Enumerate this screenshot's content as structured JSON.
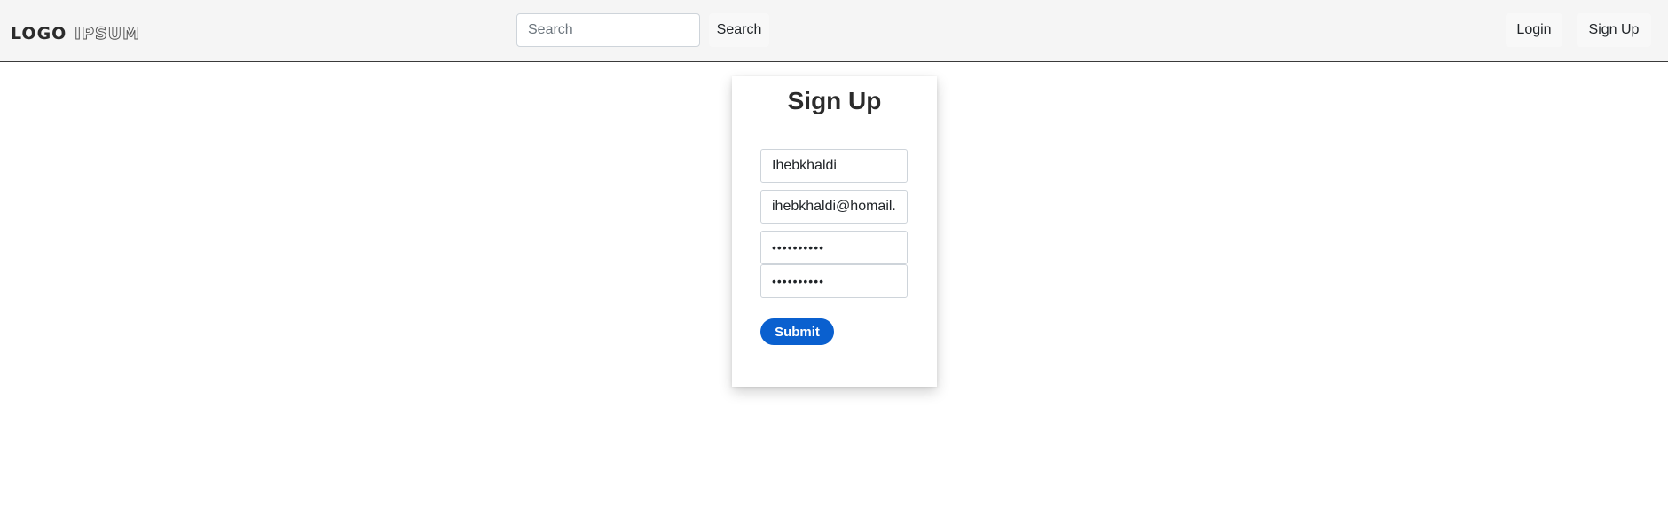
{
  "header": {
    "logo_text": "LOGOIPSUM",
    "search": {
      "placeholder": "Search",
      "value": ""
    },
    "search_button_label": "Search",
    "login_label": "Login",
    "signup_label": "Sign Up"
  },
  "signup_form": {
    "title": "Sign Up",
    "username": "Ihebkhaldi",
    "email": "ihebkhaldi@homail.",
    "password": "••••••••••",
    "confirm_password": "••••••••••",
    "submit_label": "Submit"
  },
  "colors": {
    "navbar_bg": "#f5f5f5",
    "submit_bg": "#0a60cf",
    "border": "#ced4da"
  }
}
